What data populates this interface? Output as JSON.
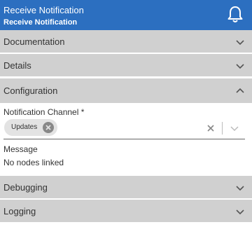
{
  "header": {
    "title": "Receive Notification",
    "subtitle": "Receive Notification",
    "icon": "bell-icon",
    "background": "#2c6fc0"
  },
  "sections": [
    {
      "label": "Documentation",
      "expanded": false
    },
    {
      "label": "Details",
      "expanded": false
    },
    {
      "label": "Configuration",
      "expanded": true
    },
    {
      "label": "Debugging",
      "expanded": false
    },
    {
      "label": "Logging",
      "expanded": false
    }
  ],
  "configuration": {
    "channel_label": "Notification Channel *",
    "channel_chip": "Updates",
    "message_label": "Message",
    "message_value": "No nodes linked"
  }
}
